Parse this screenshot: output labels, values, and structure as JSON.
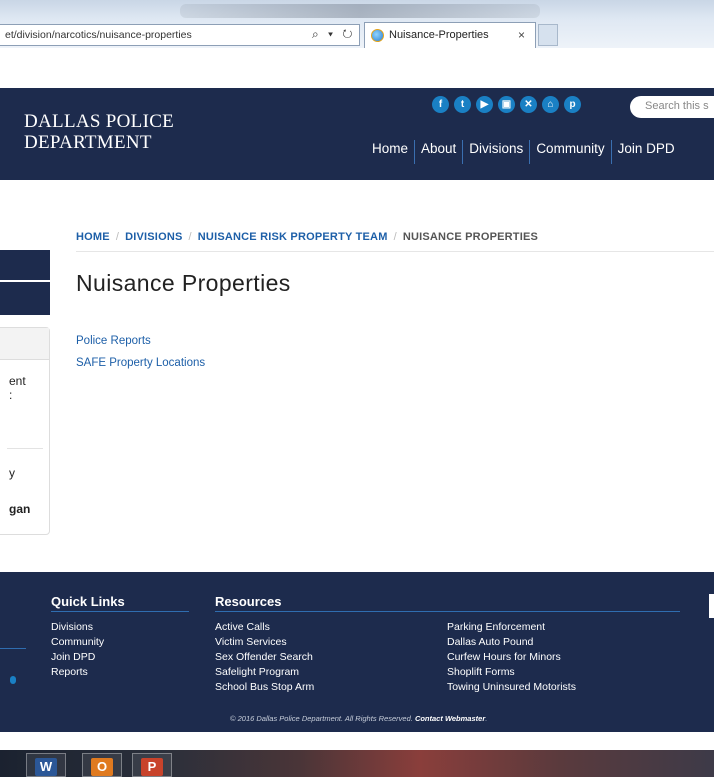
{
  "browser": {
    "address": "et/division/narcotics/nuisance-properties",
    "address_icons": "⌕ ▾ ↻",
    "tab_title": "Nuisance-Properties",
    "tab_close": "×"
  },
  "header": {
    "logo_line1": "DALLAS POLICE",
    "logo_line2": "DEPARTMENT",
    "social_icons": [
      "facebook-icon",
      "twitter-icon",
      "youtube-icon",
      "instagram-icon",
      "x-icon",
      "nextdoor-icon",
      "pinterest-icon"
    ],
    "social_glyphs": [
      "f",
      "t",
      "▶",
      "▣",
      "✕",
      "⌂",
      "p"
    ],
    "search_placeholder": "Search this s",
    "nav": [
      "Home",
      "About",
      "Divisions",
      "Community",
      "Join DPD"
    ]
  },
  "breadcrumb": {
    "items": [
      "HOME",
      "DIVISIONS",
      "NUISANCE RISK PROPERTY TEAM"
    ],
    "separator": "/",
    "current": "NUISANCE PROPERTIES"
  },
  "page": {
    "title": "Nuisance Properties",
    "links": [
      "Police Reports",
      "SAFE Property Locations"
    ]
  },
  "sidebar_fragments": {
    "t1": "ent",
    "t2": ":",
    "t3": "y",
    "t4": "gan"
  },
  "footer": {
    "quick_links_heading": "Quick Links",
    "quick_links": [
      "Divisions",
      "Community",
      "Join DPD",
      "Reports"
    ],
    "resources_heading": "Resources",
    "resources_col1": [
      "Active Calls",
      "Victim Services",
      "Sex Offender Search",
      "Safelight Program",
      "School Bus Stop Arm"
    ],
    "resources_col2": [
      "Parking Enforcement",
      "Dallas Auto Pound",
      "Curfew Hours for Minors",
      "Shoplift Forms",
      "Towing Uninsured Motorists"
    ],
    "copyright": "© 2016 Dallas Police Department. All Rights Reserved.",
    "webmaster": "Contact Webmaster"
  },
  "taskbar": {
    "apps": [
      {
        "icon": "word-icon",
        "glyph": "W",
        "color": "#2b5797"
      },
      {
        "icon": "outlook-icon",
        "glyph": "O",
        "color": "#e07a1f"
      },
      {
        "icon": "powerpoint-icon",
        "glyph": "P",
        "color": "#c8432b"
      }
    ]
  },
  "colors": {
    "header_bg": "#1d2b4d",
    "link": "#1d5fa8",
    "social": "#1a80c4"
  }
}
